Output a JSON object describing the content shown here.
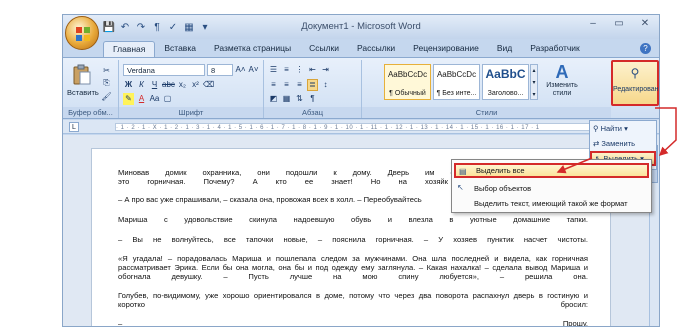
{
  "window": {
    "title": "Документ1 - Microsoft Word",
    "controls": [
      "–",
      "▭",
      "✕"
    ]
  },
  "tabs": [
    "Главная",
    "Вставка",
    "Разметка страницы",
    "Ссылки",
    "Рассылки",
    "Рецензирование",
    "Вид",
    "Разработчик"
  ],
  "ribbon": {
    "clipboard": {
      "paste_label": "Вставить",
      "group_label": "Буфер обм..."
    },
    "font": {
      "font_name": "Verdana",
      "font_size": "8",
      "bold": "Ж",
      "italic": "К",
      "underline": "Ч",
      "strike": "abc",
      "subscript": "x₂",
      "superscript": "x²",
      "grow": "A˄",
      "shrink": "A˅",
      "case": "Aa",
      "group_label": "Шрифт"
    },
    "paragraph": {
      "group_label": "Абзац"
    },
    "styles": {
      "items": [
        {
          "sample": "AaBbCcDc",
          "name": "¶ Обычный"
        },
        {
          "sample": "AaBbCcDc",
          "name": "¶ Без инте..."
        },
        {
          "sample": "AaBbC",
          "name": "Заголово..."
        }
      ],
      "change_label": "Изменить стили",
      "group_label": "Стили"
    },
    "editing": {
      "label": "Редактирование"
    }
  },
  "edit_panel": {
    "find": "Найти",
    "replace": "Заменить",
    "select": "Выделить"
  },
  "select_menu": {
    "items": [
      "Выделить все",
      "Выбор объектов",
      "Выделить текст, имеющий такой же формат"
    ]
  },
  "ruler_text": "· 1 · 2 · 1 · Ⅹ · 1 · 2 · 1 · 3 · 1 · 4 · 1 · 5 · 1 · 6 · 1 · 7 · 1 · 8 · 1 · 9 · 1 · 10 · 1 · 11 · 1 · 12 · 1 · 13 · 1 · 14 · 1 · 15 · 1 · 16 · 1 · 17 · 1",
  "document": {
    "paragraphs": [
      "Миновав домик охранника, они подошли к дому. Дверь им открыла женщина лет триц",
      "это горничная. Почему? А кто ее знает! Но на хозяйк",
      "– А про вас уже спрашивали, – сказала она, провожая всех в холл. – Переобувайтесь",
      "Мариша с удовольствие скинула надоевшую обувь и влезла в уютные домашние тапки.",
      "– Вы не волнуйтесь, все тапочки новые, – пояснила горничная. – У хозяев пунктик насчет чистоты.",
      "«Я угадала! – порадовалась Мариша и пошлепала следом за мужчинами. Она шла последней и видела, как горничная",
      "рассматривает Эрика. Если бы она могла, она бы и под одежду ему заглянула. – Какая нахалка! – сделала вывод Мариша и",
      "обогнала девушку. – Пусть лучше на мою спину любуется», – решила она.",
      "Голубев, по-видимому, уже хорошо ориентировался в доме, потому что через два поворота распахнул дверь в гостиную и",
      "коротко бросил:",
      "–",
      "Прошу."
    ]
  },
  "colors": {
    "highlight_border": "#d42a2a",
    "ribbon_bg": "#cfdff3"
  }
}
